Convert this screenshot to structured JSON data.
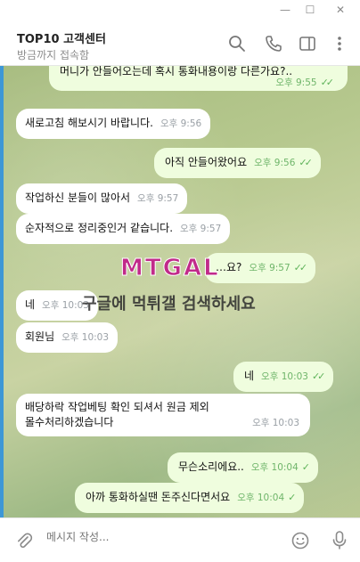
{
  "window": {
    "min": "—",
    "max": "☐",
    "close": "✕"
  },
  "header": {
    "title": "TOP10 고객센터",
    "status": "방금까지 접속함"
  },
  "messages": [
    {
      "dir": "out",
      "text": "머니가 안들어오는데 혹시 통화내용이랑 다른가요?..",
      "time": "오후 9:55",
      "ticks": "✓✓"
    },
    {
      "dir": "in",
      "text": "새로고침 해보시기 바랍니다.",
      "time": "오후 9:56"
    },
    {
      "dir": "out",
      "text": "아직 안들어왔어요",
      "time": "오후 9:56",
      "ticks": "✓✓"
    },
    {
      "dir": "in",
      "text": "작업하신 분들이 많아서",
      "time": "오후 9:57"
    },
    {
      "dir": "in",
      "text": "순자적으로 정리중인거 같습니다.",
      "time": "오후 9:57"
    },
    {
      "dir": "out",
      "text": "…요?",
      "time": "오후 9:57",
      "ticks": "✓✓"
    },
    {
      "dir": "in",
      "text": "네",
      "time": "오후 10:03"
    },
    {
      "dir": "in",
      "text": "회원님",
      "time": "오후 10:03"
    },
    {
      "dir": "out",
      "text": "네",
      "time": "오후 10:03",
      "ticks": "✓✓"
    },
    {
      "dir": "in",
      "text": "배당하락 작업베팅 확인 되셔서 원금 제외",
      "text2": "몰수처리하겠습니다",
      "time": "오후 10:03"
    },
    {
      "dir": "out",
      "text": "무슨소리에요..",
      "time": "오후 10:04",
      "ticks": "✓"
    },
    {
      "dir": "out",
      "text": "아까 통화하실땐 돈주신다면서요",
      "time": "오후 10:04",
      "ticks": "✓"
    }
  ],
  "watermark": {
    "logo": "MTGAL",
    "text": "구글에 먹튀갤 검색하세요"
  },
  "composer": {
    "placeholder": "메시지 작성..."
  },
  "colors": {
    "accent": "#3d97d6",
    "outgoing_bubble": "#effdde",
    "incoming_bubble": "#ffffff",
    "check": "#5fb35a"
  },
  "icons": [
    "search-icon",
    "phone-icon",
    "sidebar-icon",
    "more-icon",
    "paperclip-icon",
    "emoji-icon",
    "microphone-icon"
  ]
}
